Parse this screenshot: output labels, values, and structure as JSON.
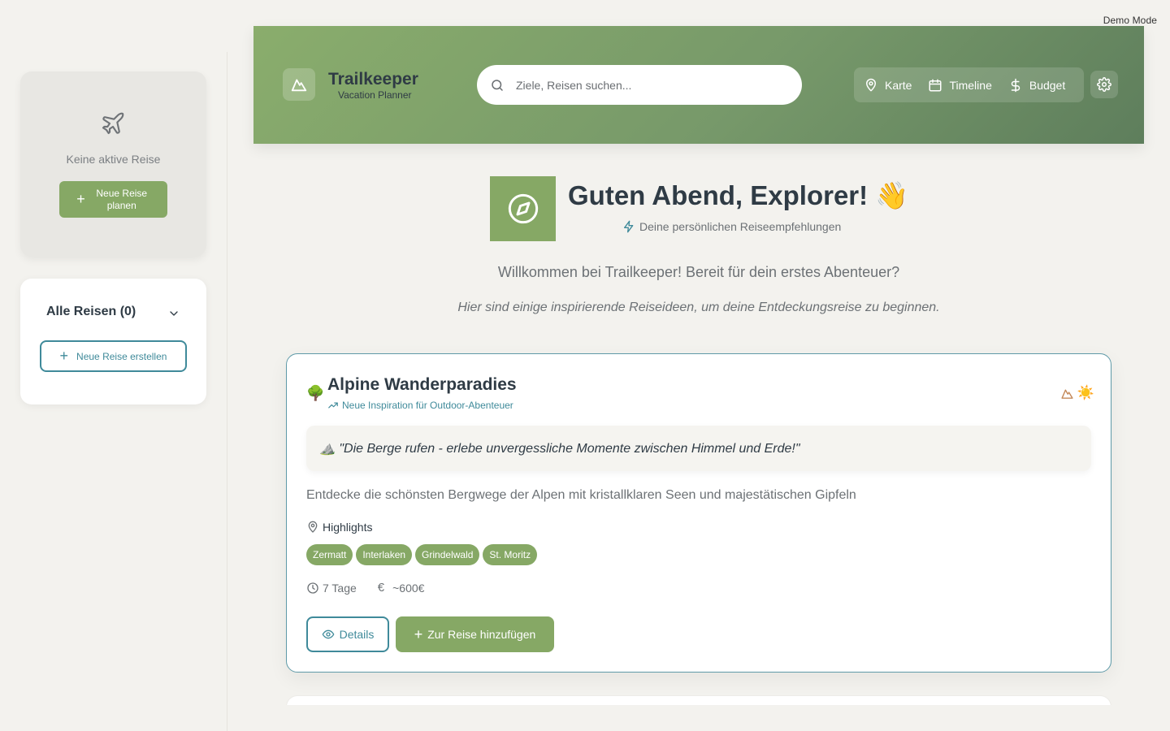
{
  "demo_mode": "Demo Mode",
  "colors": {
    "primary_green": "#86a865",
    "teal": "#3f8a9a",
    "text_dark": "#2f3b45"
  },
  "sidebar": {
    "active_trip": {
      "icon": "plane-icon",
      "empty_text": "Keine aktive Reise",
      "new_button": "Neue Reise planen"
    },
    "all_trips": {
      "title": "Alle Reisen (0)",
      "create_button": "Neue Reise erstellen"
    }
  },
  "header": {
    "brand": "Trailkeeper",
    "brand_sub": "Vacation Planner",
    "search_placeholder": "Ziele, Reisen suchen...",
    "nav": [
      {
        "label": "Karte",
        "icon": "map-pin-icon"
      },
      {
        "label": "Timeline",
        "icon": "calendar-icon"
      },
      {
        "label": "Budget",
        "icon": "dollar-icon"
      }
    ]
  },
  "greeting": {
    "title": "Guten Abend, Explorer! 👋",
    "subtitle": "Deine persönlichen Reiseempfehlungen",
    "welcome": "Willkommen bei Trailkeeper! Bereit für dein erstes Abenteuer?",
    "welcome_sub": "Hier sind einige inspirierende Reiseideen, um deine Entdeckungsreise zu beginnen."
  },
  "card": {
    "emoji": "🌳",
    "title": "Alpine Wanderparadies",
    "subtitle": "Neue Inspiration für Outdoor-Abenteuer",
    "weather_emoji": "☀️",
    "quote": "⛰️ \"Die Berge rufen - erlebe unvergessliche Momente zwischen Himmel und Erde!\"",
    "description": "Entdecke die schönsten Bergwege der Alpen mit kristallklaren Seen und majestätischen Gipfeln",
    "highlights_label": "Highlights",
    "highlights": [
      "Zermatt",
      "Interlaken",
      "Grindelwald",
      "St. Moritz"
    ],
    "duration": "7 Tage",
    "budget": "~600€",
    "details_button": "Details",
    "add_button": "Zur Reise hinzufügen"
  }
}
